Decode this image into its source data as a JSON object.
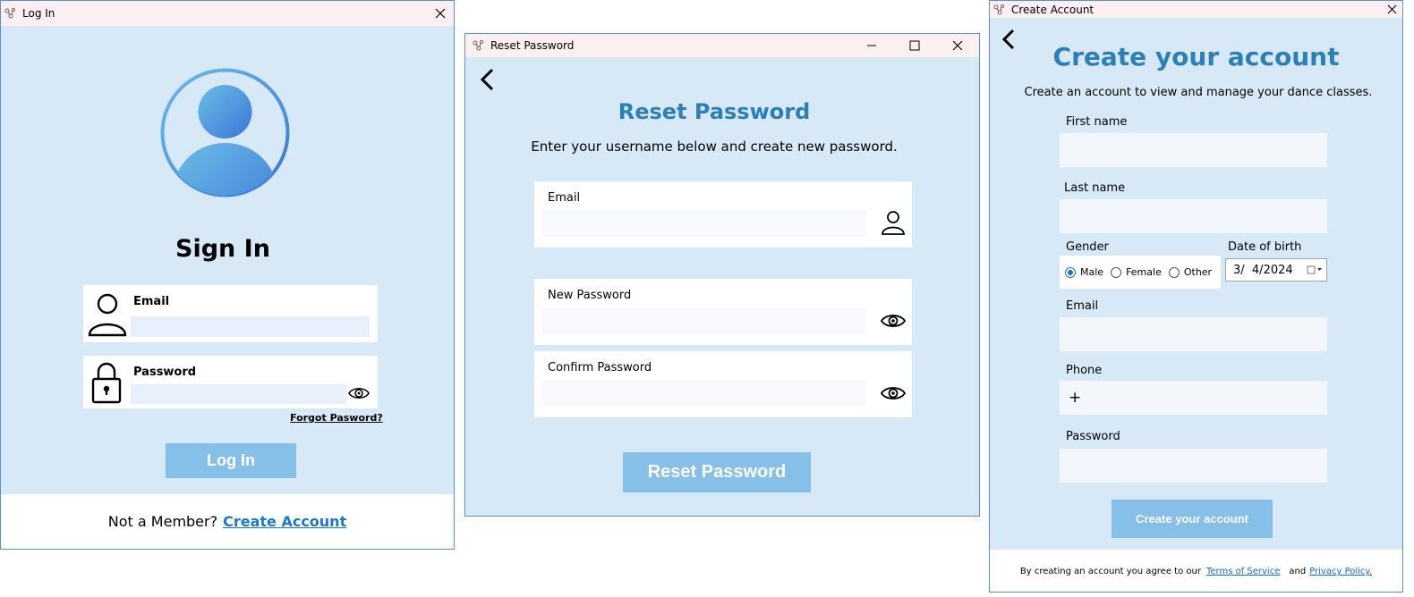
{
  "login": {
    "window_title": "Log In",
    "heading": "Sign In",
    "email_label": "Email",
    "email_value": "",
    "password_label": "Password",
    "password_value": "",
    "forgot_label": "Forgot Pasword?",
    "login_button": "Log In",
    "not_member": "Not a Member?",
    "create_link": "Create Account",
    "colors": {
      "accent": "#1a78d0",
      "button": "#86bfe8",
      "background": "#d7e9f7"
    }
  },
  "reset": {
    "window_title": "Reset Password",
    "heading": "Reset Password",
    "subtitle": "Enter your username below and create new password.",
    "email_label": "Email",
    "new_password_label": "New Password",
    "confirm_password_label": "Confirm Password",
    "reset_button": "Reset Password",
    "colors": {
      "heading": "#2d7fb8"
    }
  },
  "create": {
    "window_title": "Create Account",
    "heading": "Create your account",
    "subtitle": "Create an account to view and manage your dance classes.",
    "first_name_label": "First name",
    "last_name_label": "Last name",
    "gender_label": "Gender",
    "gender_options": [
      "Male",
      "Female",
      "Other"
    ],
    "gender_selected": "Male",
    "dob_label": "Date of birth",
    "dob_value": "3/  4/2024",
    "email_label": "Email",
    "phone_label": "Phone",
    "phone_value": "+",
    "password_label": "Password",
    "create_button": "Create your account",
    "footer_prefix": "By creating an account you agree to our",
    "terms_link": "Terms of Service",
    "and_text": "and",
    "privacy_link": "Privacy Policy."
  }
}
